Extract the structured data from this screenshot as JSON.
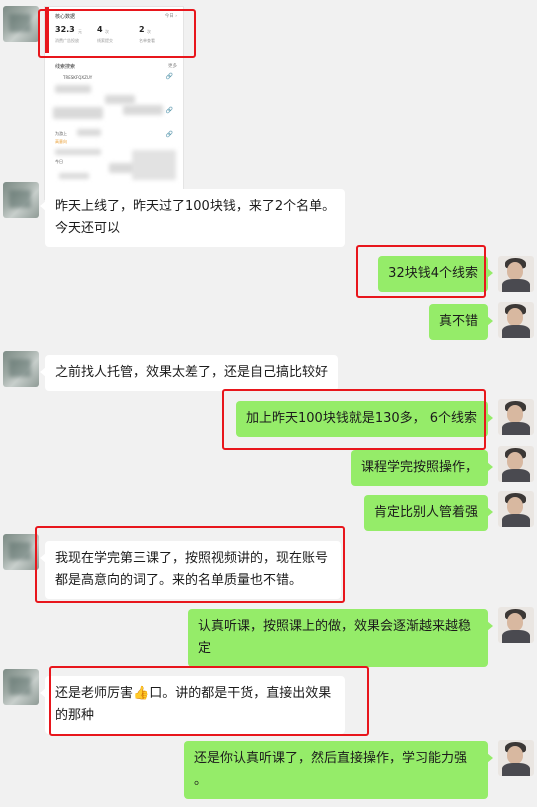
{
  "card": {
    "core_title": "核心数据",
    "core_more": "今日 ›",
    "metrics": [
      {
        "value": "32.3",
        "unit": "元",
        "label": "消费广告投放"
      },
      {
        "value": "4",
        "unit": "次",
        "label": "线索提交"
      },
      {
        "value": "2",
        "unit": "次",
        "label": "名单查看"
      }
    ],
    "leads_title": "线索搜索",
    "leads_more": "更多",
    "leads_id": "TRESKFQXZUY",
    "leads_second": "为游上",
    "leads_tag": "高意向",
    "leads_date": "今日"
  },
  "messages": [
    {
      "side": "in",
      "lines": [
        "昨天上线了，昨天过了100块钱，来了2个名单。",
        "今天还可以"
      ]
    },
    {
      "side": "out",
      "lines": [
        "32块钱4个线索"
      ]
    },
    {
      "side": "out",
      "lines": [
        "真不错"
      ]
    },
    {
      "side": "in",
      "lines": [
        "之前找人托管，效果太差了，还是自己搞比较好"
      ]
    },
    {
      "side": "out",
      "lines": [
        "加上昨天100块钱就是130多， 6个线索"
      ]
    },
    {
      "side": "out",
      "lines": [
        "课程学完按照操作，"
      ]
    },
    {
      "side": "out",
      "lines": [
        "肯定比别人管着强"
      ]
    },
    {
      "side": "in",
      "lines": [
        "我现在学完第三课了，按照视频讲的，现在账号",
        "都是高意向的词了。来的名单质量也不错。"
      ]
    },
    {
      "side": "out",
      "lines": [
        "认真听课，按照课上的做，效果会逐渐越来越稳",
        "定"
      ]
    },
    {
      "side": "in",
      "lines": [
        "还是老师厉害",
        "口。讲的都是干货，直接出效果",
        "的那种"
      ]
    },
    {
      "side": "out",
      "lines": [
        "还是你认真听课了，然后直接操作，学习能力强",
        "。"
      ]
    }
  ],
  "emoji": {
    "thumb": "👍"
  },
  "colors": {
    "highlight": "#e8161c",
    "outgoing": "#95ec69",
    "incoming": "#ffffff",
    "background": "#f1f1f1"
  }
}
